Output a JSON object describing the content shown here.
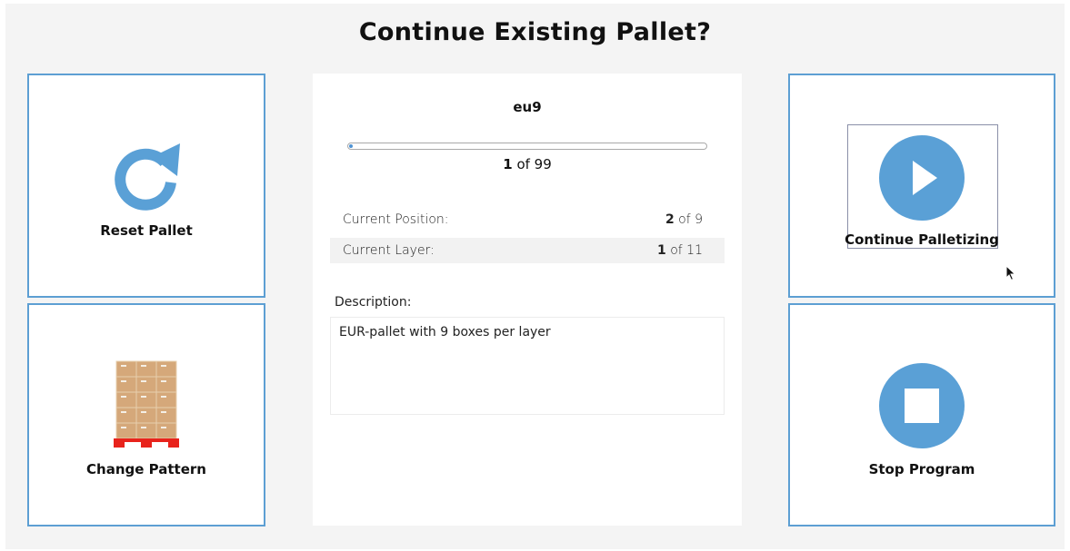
{
  "title": "Continue Existing Pallet?",
  "colors": {
    "accent": "#5aa0d6",
    "tile_border": "#5d9fd3",
    "pallet_red": "#e8231c",
    "box_tan": "#d5a87a"
  },
  "tiles": {
    "reset": {
      "label": "Reset Pallet",
      "icon": "refresh-icon"
    },
    "pattern": {
      "label": "Change Pattern",
      "icon": "pallet-boxes-icon"
    },
    "continue": {
      "label": "Continue Palletizing",
      "icon": "play-icon"
    },
    "stop": {
      "label": "Stop Program",
      "icon": "stop-icon"
    }
  },
  "info": {
    "pattern_name": "eu9",
    "progress": {
      "current": "1",
      "total_text": " of 99",
      "fraction": 0.0101
    },
    "position": {
      "label": "Current Position:",
      "current": "2",
      "total_text": " of 9"
    },
    "layer": {
      "label": "Current Layer:",
      "current": "1",
      "total_text": " of 11"
    },
    "description_label": "Description:",
    "description": "EUR-pallet with 9 boxes per layer"
  }
}
